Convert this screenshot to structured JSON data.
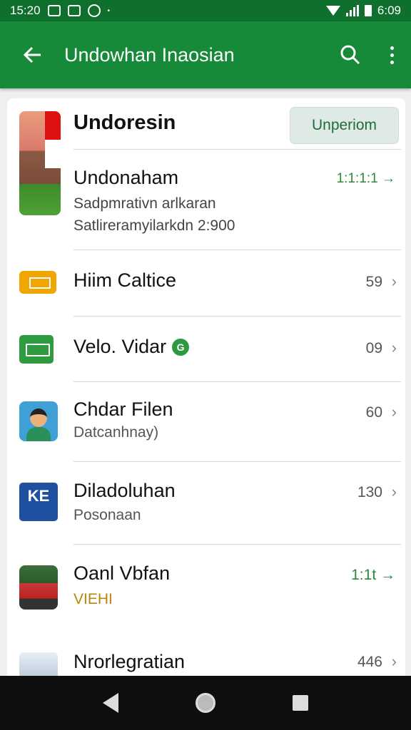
{
  "status_bar": {
    "time_left": "15:20",
    "time_right": "6:09"
  },
  "app_bar": {
    "title": "Undowhan Inaosian"
  },
  "featured": {
    "title": "Undoresin",
    "action_label": "Unperiom",
    "subtitle": "Undonaham",
    "line1": "Sadpmrativn arlkaran",
    "line2": "Satlireramyilarkdn 2:900",
    "count": "1:1:1:1 →"
  },
  "rows": [
    {
      "title": "Hiim Caltice",
      "subtitle": "",
      "count": "59",
      "icon": "ticket-icon"
    },
    {
      "title": "Velo. Vidar",
      "subtitle": "",
      "count": "09",
      "icon": "chat-icon",
      "badge": "G"
    },
    {
      "title": "Chdar Filen",
      "subtitle": "Datcanhnay)",
      "count": "60",
      "icon": "person-icon"
    },
    {
      "title": "Diladoluhan",
      "subtitle": "Posonaan",
      "count": "130",
      "icon": "ke-logo-icon",
      "icon_text": "KE"
    },
    {
      "title": "Oanl Vbfan",
      "subtitle": "VIEHI",
      "count": "1:1t →",
      "icon": "photo-icon"
    },
    {
      "title": "Nrorlegratian",
      "subtitle": "",
      "count": "446",
      "icon": "image-icon"
    }
  ],
  "colors": {
    "app_bar": "#178a3a",
    "status_bar": "#0f6f2c",
    "accent_green": "#2a8a3a",
    "subtitle_gold": "#b8860b"
  }
}
